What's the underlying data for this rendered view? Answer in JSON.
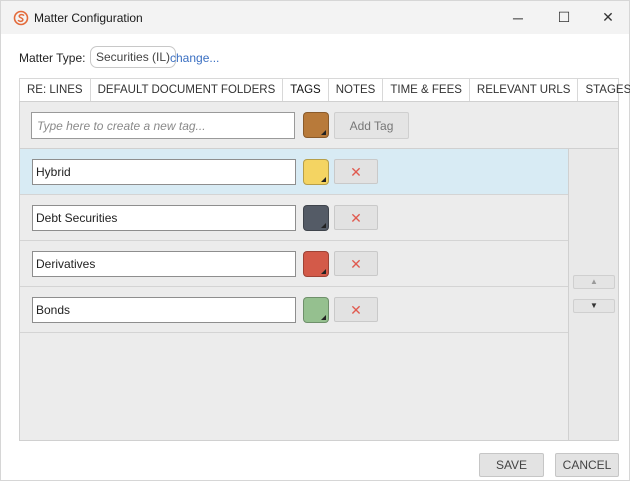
{
  "window": {
    "title": "Matter Configuration",
    "controls": {
      "minimize": "─",
      "maximize": "☐",
      "close": "✕"
    }
  },
  "matter": {
    "label": "Matter Type:",
    "value": "Securities (IL)",
    "change_link": "change..."
  },
  "tabs": [
    {
      "label": "RE: LINES"
    },
    {
      "label": "DEFAULT DOCUMENT FOLDERS"
    },
    {
      "label": "TAGS",
      "active": true
    },
    {
      "label": "NOTES"
    },
    {
      "label": "TIME & FEES"
    },
    {
      "label": "RELEVANT URLS"
    },
    {
      "label": "STAGES"
    }
  ],
  "new_tag": {
    "placeholder": "Type here to create a new tag...",
    "color": "#b87a3a",
    "add_label": "Add Tag"
  },
  "tags": [
    {
      "name": "Hybrid",
      "color": "#f4d462",
      "selected": true
    },
    {
      "name": "Debt Securities",
      "color": "#545b66",
      "selected": false
    },
    {
      "name": "Derivatives",
      "color": "#d35a49",
      "selected": false
    },
    {
      "name": "Bonds",
      "color": "#95c08f",
      "selected": false
    }
  ],
  "delete_symbol": "✕",
  "move": {
    "up_symbol": "▲",
    "down_symbol": "▼"
  },
  "footer": {
    "save_label": "SAVE",
    "cancel_label": "CANCEL"
  }
}
